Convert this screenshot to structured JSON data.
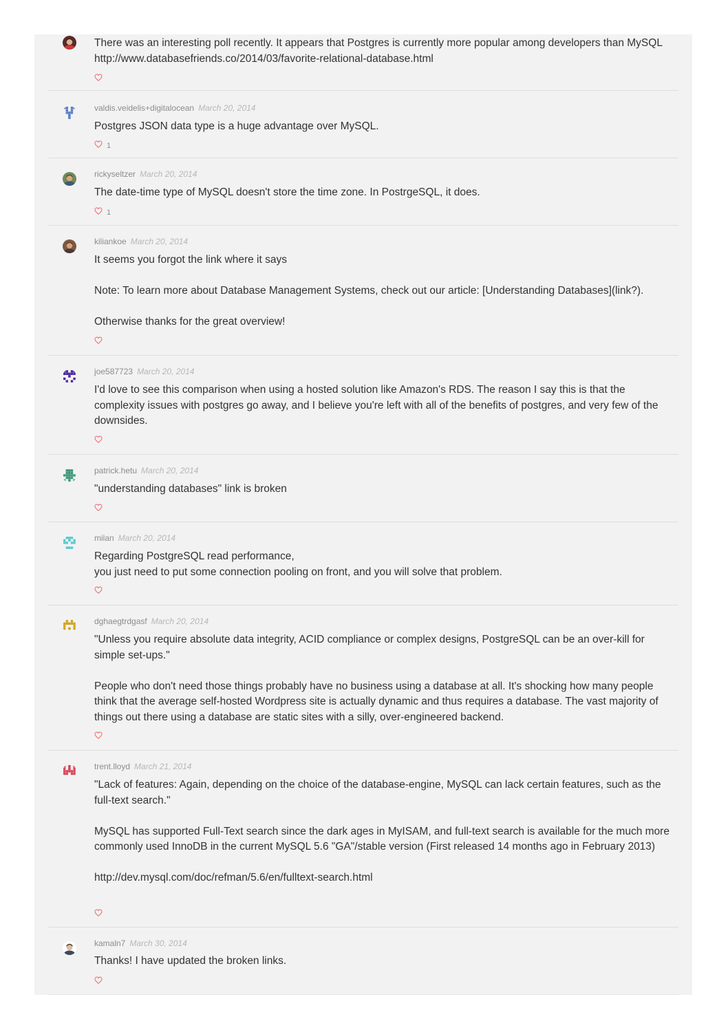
{
  "colors": {
    "panel_bg": "#f2f2f2",
    "divider": "#dedede",
    "heart": "#ee6f77",
    "author": "#8c8c8c",
    "date": "#b7b7b7",
    "text": "#333333"
  },
  "comments": [
    {
      "author": "",
      "date": "",
      "avatar_icon": "photo-avatar-man-icon",
      "paragraphs": [
        "There was an interesting poll recently. It appears that Postgres is currently more popular among developers than MySQL http://www.databasefriends.co/2014/03/favorite-relational-database.html"
      ],
      "likes": ""
    },
    {
      "author": "valdis.veidelis+digitalocean",
      "date": "March 20, 2014",
      "avatar_icon": "identicon-blue-icon",
      "paragraphs": [
        "Postgres JSON data type is a huge advantage over MySQL."
      ],
      "likes": "1"
    },
    {
      "author": "rickyseltzer",
      "date": "March 20, 2014",
      "avatar_icon": "photo-avatar-outdoor-icon",
      "paragraphs": [
        "The date-time type of MySQL doesn't store the time zone. In PostrgeSQL, it does."
      ],
      "likes": "1"
    },
    {
      "author": "kiliankoe",
      "date": "March 20, 2014",
      "avatar_icon": "photo-avatar-brown-icon",
      "paragraphs": [
        "It seems you forgot the link where it says",
        "Note: To learn more about Database Management Systems, check out our article: [Understanding Databases](link?).",
        "Otherwise thanks for the great overview!"
      ],
      "likes": ""
    },
    {
      "author": "joe587723",
      "date": "March 20, 2014",
      "avatar_icon": "identicon-purple-icon",
      "paragraphs": [
        "I'd love to see this comparison when using a hosted solution like Amazon's RDS. The reason I say this is that the complexity issues with postgres go away, and I believe you're left with all of the benefits of postgres, and very few of the downsides."
      ],
      "likes": ""
    },
    {
      "author": "patrick.hetu",
      "date": "March 20, 2014",
      "avatar_icon": "identicon-green-icon",
      "paragraphs": [
        "\"understanding databases\" link is broken"
      ],
      "likes": ""
    },
    {
      "author": "milan",
      "date": "March 20, 2014",
      "avatar_icon": "identicon-cyan-icon",
      "paragraphs": [
        "Regarding PostgreSQL read performance,\nyou just need to put some connection pooling on front, and you will solve that problem."
      ],
      "likes": ""
    },
    {
      "author": "dghaegtrdgasf",
      "date": "March 20, 2014",
      "avatar_icon": "identicon-gold-icon",
      "paragraphs": [
        "\"Unless you require absolute data integrity, ACID compliance or complex designs, PostgreSQL can be an over-kill for simple set-ups.\"",
        "People who don't need those things probably have no business using a database at all. It's shocking how many people think that the average self-hosted Wordpress site is actually dynamic and thus requires a database. The vast majority of things out there using a database are static sites with a silly, over-engineered backend."
      ],
      "likes": ""
    },
    {
      "author": "trent.lloyd",
      "date": "March 21, 2014",
      "avatar_icon": "identicon-red-icon",
      "paragraphs": [
        "\"Lack of features: Again, depending on the choice of the database-engine, MySQL can lack certain features, such as the full-text search.\"",
        "MySQL has supported Full-Text search since the dark ages in MyISAM, and full-text search is available for the much more commonly used InnoDB in the current MySQL 5.6 \"GA\"/stable version (First released 14 months ago in February 2013)",
        "http://dev.mysql.com/doc/refman/5.6/en/fulltext-search.html"
      ],
      "likes": ""
    },
    {
      "author": "kamaln7",
      "date": "March 30, 2014",
      "avatar_icon": "photo-avatar-person-icon",
      "paragraphs": [
        "Thanks! I have updated the broken links."
      ],
      "likes": ""
    }
  ]
}
